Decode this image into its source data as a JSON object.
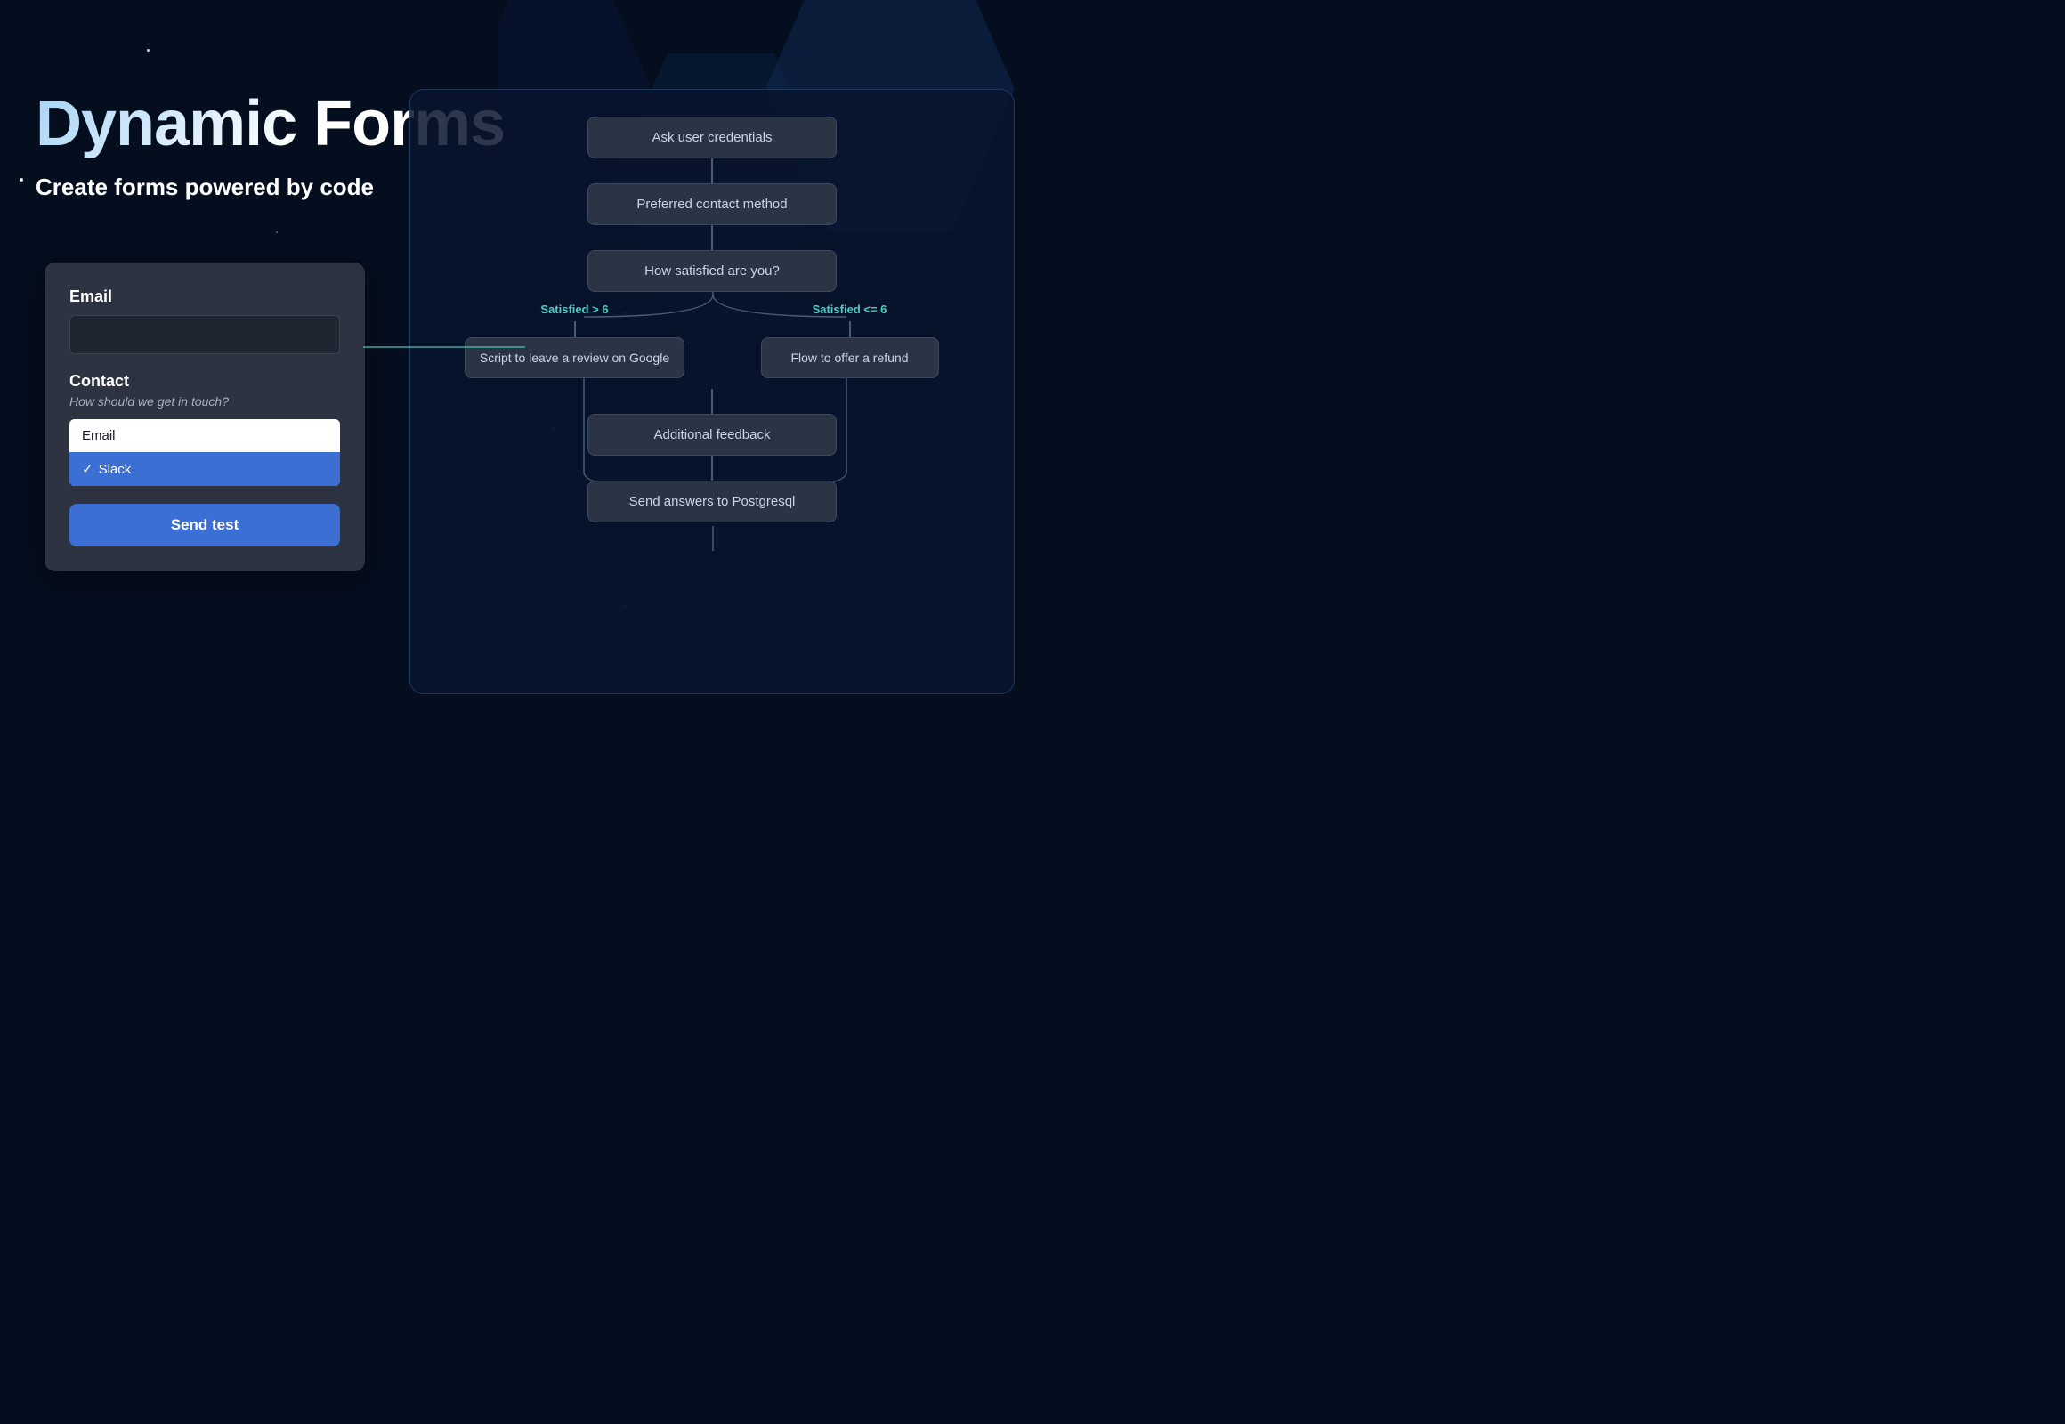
{
  "page": {
    "title": "Dynamic Forms",
    "subtitle": "Create forms powered by code"
  },
  "form": {
    "email_label": "Email",
    "email_placeholder": "",
    "contact_label": "Contact",
    "contact_subtitle": "How should we get in touch?",
    "options": [
      {
        "label": "Email",
        "selected": false
      },
      {
        "label": "Slack",
        "selected": true
      }
    ],
    "send_button": "Send test"
  },
  "flow": {
    "nodes": [
      {
        "id": "credentials",
        "label": "Ask user credentials"
      },
      {
        "id": "contact",
        "label": "Preferred contact method"
      },
      {
        "id": "satisfaction",
        "label": "How satisfied are you?"
      },
      {
        "id": "review",
        "label": "Script to leave a review on Google"
      },
      {
        "id": "refund",
        "label": "Flow to offer a refund"
      },
      {
        "id": "feedback",
        "label": "Additional feedback"
      },
      {
        "id": "postgresql",
        "label": "Send answers to Postgresql"
      }
    ],
    "branch_labels": {
      "left": "Satisfied > 6",
      "right": "Satisfied <= 6"
    }
  }
}
